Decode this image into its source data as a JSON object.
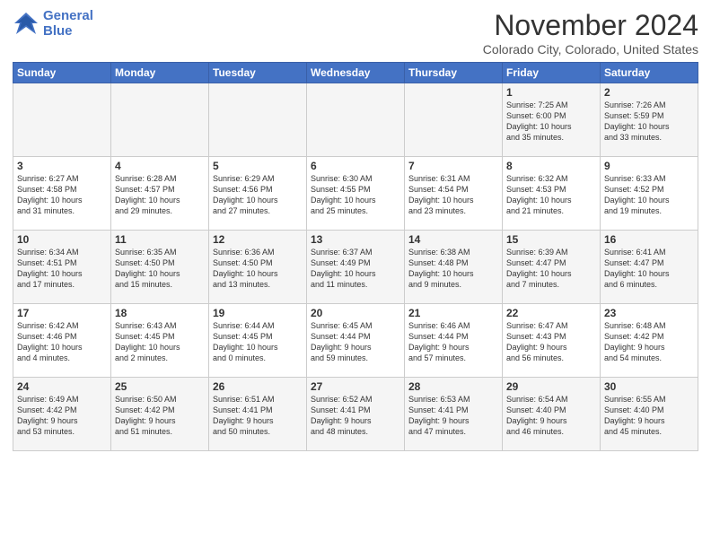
{
  "logo": {
    "line1": "General",
    "line2": "Blue"
  },
  "title": "November 2024",
  "location": "Colorado City, Colorado, United States",
  "days_of_week": [
    "Sunday",
    "Monday",
    "Tuesday",
    "Wednesday",
    "Thursday",
    "Friday",
    "Saturday"
  ],
  "weeks": [
    [
      {
        "day": "",
        "info": ""
      },
      {
        "day": "",
        "info": ""
      },
      {
        "day": "",
        "info": ""
      },
      {
        "day": "",
        "info": ""
      },
      {
        "day": "",
        "info": ""
      },
      {
        "day": "1",
        "info": "Sunrise: 7:25 AM\nSunset: 6:00 PM\nDaylight: 10 hours\nand 35 minutes."
      },
      {
        "day": "2",
        "info": "Sunrise: 7:26 AM\nSunset: 5:59 PM\nDaylight: 10 hours\nand 33 minutes."
      }
    ],
    [
      {
        "day": "3",
        "info": "Sunrise: 6:27 AM\nSunset: 4:58 PM\nDaylight: 10 hours\nand 31 minutes."
      },
      {
        "day": "4",
        "info": "Sunrise: 6:28 AM\nSunset: 4:57 PM\nDaylight: 10 hours\nand 29 minutes."
      },
      {
        "day": "5",
        "info": "Sunrise: 6:29 AM\nSunset: 4:56 PM\nDaylight: 10 hours\nand 27 minutes."
      },
      {
        "day": "6",
        "info": "Sunrise: 6:30 AM\nSunset: 4:55 PM\nDaylight: 10 hours\nand 25 minutes."
      },
      {
        "day": "7",
        "info": "Sunrise: 6:31 AM\nSunset: 4:54 PM\nDaylight: 10 hours\nand 23 minutes."
      },
      {
        "day": "8",
        "info": "Sunrise: 6:32 AM\nSunset: 4:53 PM\nDaylight: 10 hours\nand 21 minutes."
      },
      {
        "day": "9",
        "info": "Sunrise: 6:33 AM\nSunset: 4:52 PM\nDaylight: 10 hours\nand 19 minutes."
      }
    ],
    [
      {
        "day": "10",
        "info": "Sunrise: 6:34 AM\nSunset: 4:51 PM\nDaylight: 10 hours\nand 17 minutes."
      },
      {
        "day": "11",
        "info": "Sunrise: 6:35 AM\nSunset: 4:50 PM\nDaylight: 10 hours\nand 15 minutes."
      },
      {
        "day": "12",
        "info": "Sunrise: 6:36 AM\nSunset: 4:50 PM\nDaylight: 10 hours\nand 13 minutes."
      },
      {
        "day": "13",
        "info": "Sunrise: 6:37 AM\nSunset: 4:49 PM\nDaylight: 10 hours\nand 11 minutes."
      },
      {
        "day": "14",
        "info": "Sunrise: 6:38 AM\nSunset: 4:48 PM\nDaylight: 10 hours\nand 9 minutes."
      },
      {
        "day": "15",
        "info": "Sunrise: 6:39 AM\nSunset: 4:47 PM\nDaylight: 10 hours\nand 7 minutes."
      },
      {
        "day": "16",
        "info": "Sunrise: 6:41 AM\nSunset: 4:47 PM\nDaylight: 10 hours\nand 6 minutes."
      }
    ],
    [
      {
        "day": "17",
        "info": "Sunrise: 6:42 AM\nSunset: 4:46 PM\nDaylight: 10 hours\nand 4 minutes."
      },
      {
        "day": "18",
        "info": "Sunrise: 6:43 AM\nSunset: 4:45 PM\nDaylight: 10 hours\nand 2 minutes."
      },
      {
        "day": "19",
        "info": "Sunrise: 6:44 AM\nSunset: 4:45 PM\nDaylight: 10 hours\nand 0 minutes."
      },
      {
        "day": "20",
        "info": "Sunrise: 6:45 AM\nSunset: 4:44 PM\nDaylight: 9 hours\nand 59 minutes."
      },
      {
        "day": "21",
        "info": "Sunrise: 6:46 AM\nSunset: 4:44 PM\nDaylight: 9 hours\nand 57 minutes."
      },
      {
        "day": "22",
        "info": "Sunrise: 6:47 AM\nSunset: 4:43 PM\nDaylight: 9 hours\nand 56 minutes."
      },
      {
        "day": "23",
        "info": "Sunrise: 6:48 AM\nSunset: 4:42 PM\nDaylight: 9 hours\nand 54 minutes."
      }
    ],
    [
      {
        "day": "24",
        "info": "Sunrise: 6:49 AM\nSunset: 4:42 PM\nDaylight: 9 hours\nand 53 minutes."
      },
      {
        "day": "25",
        "info": "Sunrise: 6:50 AM\nSunset: 4:42 PM\nDaylight: 9 hours\nand 51 minutes."
      },
      {
        "day": "26",
        "info": "Sunrise: 6:51 AM\nSunset: 4:41 PM\nDaylight: 9 hours\nand 50 minutes."
      },
      {
        "day": "27",
        "info": "Sunrise: 6:52 AM\nSunset: 4:41 PM\nDaylight: 9 hours\nand 48 minutes."
      },
      {
        "day": "28",
        "info": "Sunrise: 6:53 AM\nSunset: 4:41 PM\nDaylight: 9 hours\nand 47 minutes."
      },
      {
        "day": "29",
        "info": "Sunrise: 6:54 AM\nSunset: 4:40 PM\nDaylight: 9 hours\nand 46 minutes."
      },
      {
        "day": "30",
        "info": "Sunrise: 6:55 AM\nSunset: 4:40 PM\nDaylight: 9 hours\nand 45 minutes."
      }
    ]
  ]
}
